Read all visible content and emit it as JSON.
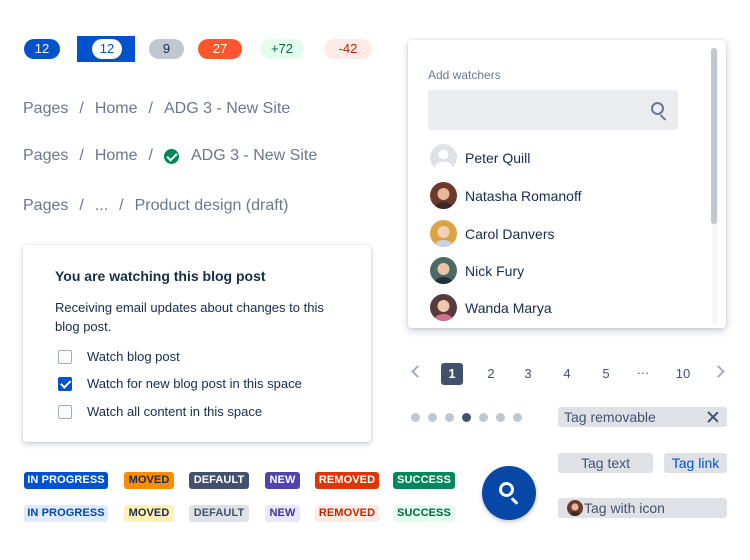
{
  "badges": [
    "12",
    "12",
    "9",
    "27",
    "+72",
    "-42"
  ],
  "breadcrumbs": [
    {
      "items": [
        "Pages",
        "Home",
        "ADG 3 - New Site"
      ]
    },
    {
      "items": [
        "Pages",
        "Home",
        "ADG 3 - New Site"
      ],
      "icon": "check-circle-icon"
    },
    {
      "items": [
        "Pages",
        "...",
        "Product design (draft)"
      ]
    }
  ],
  "watch_card": {
    "title": "You are watching this blog post",
    "description": "Receiving email updates about changes to this blog post.",
    "options": [
      {
        "label": "Watch blog post",
        "checked": false
      },
      {
        "label": "Watch for new blog post in this space",
        "checked": true
      },
      {
        "label": "Watch all content in this space",
        "checked": false
      }
    ]
  },
  "lozenges_bold": [
    "IN PROGRESS",
    "MOVED",
    "DEFAULT",
    "NEW",
    "REMOVED",
    "SUCCESS"
  ],
  "lozenges_subtle": [
    "IN PROGRESS",
    "MOVED",
    "DEFAULT",
    "NEW",
    "REMOVED",
    "SUCCESS"
  ],
  "watchers": {
    "title": "Add watchers",
    "search_placeholder": "",
    "people": [
      "Peter Quill",
      "Natasha Romanoff",
      "Carol Danvers",
      "Nick Fury",
      "Wanda Marya"
    ]
  },
  "pagination": {
    "pages": [
      "1",
      "2",
      "3",
      "4",
      "5",
      "…",
      "10"
    ],
    "current": "1"
  },
  "tags": {
    "removable": "Tag removable",
    "text": "Tag text",
    "link": "Tag link",
    "with_icon": "Tag with icon"
  },
  "colors": {
    "primary": "#0052CC",
    "success": "#00875A",
    "danger": "#FF5630",
    "warning": "#FF8B00",
    "purple": "#5243AA",
    "neutral": "#42526E"
  }
}
